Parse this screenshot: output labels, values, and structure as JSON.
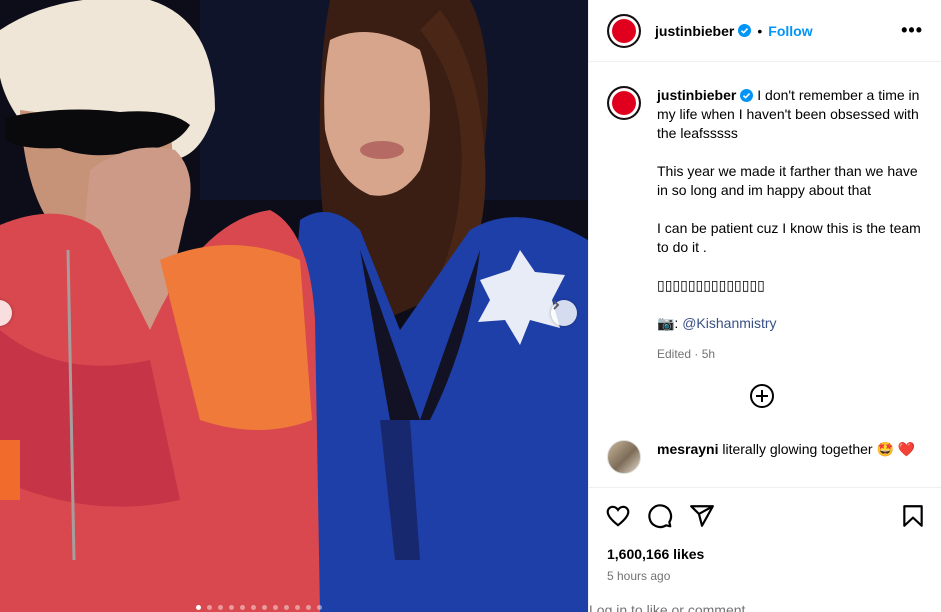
{
  "post": {
    "author": "justinbieber",
    "follow_label": "Follow",
    "separator": "•",
    "more_label": "•••",
    "caption_lines": [
      "I don't remember a time in my life when I haven't been obsessed with the leafsssss",
      "This year we made it farther than we have in so long and im happy about that",
      "I can be patient cuz I know this is the team to do it .",
      "▯▯▯▯▯▯▯▯▯▯▯▯▯▯",
      "📷: "
    ],
    "photo_credit": "@Kishanmistry",
    "edited_label": "Edited · 5h"
  },
  "comment": {
    "user": "mesrayni",
    "text": "literally glowing together 🤩 ❤️"
  },
  "stats": {
    "likes": "1,600,166 likes",
    "time": "5 hours ago",
    "login_prompt": "Log in to like or comment."
  },
  "carousel": {
    "total": 12,
    "active": 0
  },
  "icons": {
    "verified": "verified-badge-icon",
    "add": "add-comment-icon",
    "like": "heart-icon",
    "comment": "comment-icon",
    "share": "share-icon",
    "save": "bookmark-icon"
  },
  "colors": {
    "accent": "#0095f6",
    "avatar": "#e0001e",
    "muted": "#737373"
  }
}
